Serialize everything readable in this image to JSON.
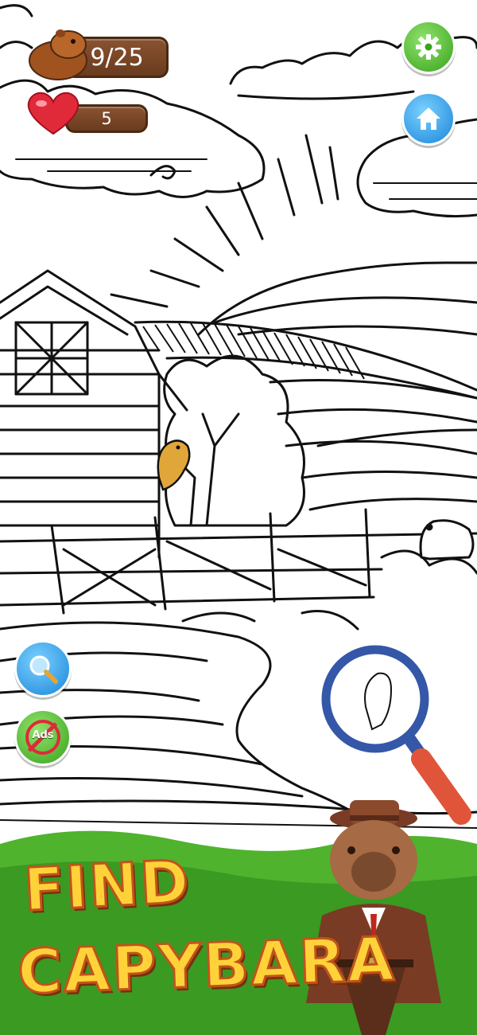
{
  "hud": {
    "score": "9/25",
    "lives": "5"
  },
  "buttons": {
    "ads_label": "Ads"
  },
  "title": {
    "line1": "FIND",
    "line2": "CAPYBARA"
  },
  "colors": {
    "wood": "#6a3b1f",
    "green_button": "#3aa21e",
    "blue_button": "#1a86d8",
    "title_fill": "#ffd23a",
    "title_stroke": "#c0541a",
    "grass": "#4fb32e",
    "found_capybara": "#e0a63a"
  },
  "icons": [
    "capybara-icon",
    "heart-icon",
    "gear-icon",
    "home-icon",
    "magnifier-icon",
    "ads-icon"
  ]
}
